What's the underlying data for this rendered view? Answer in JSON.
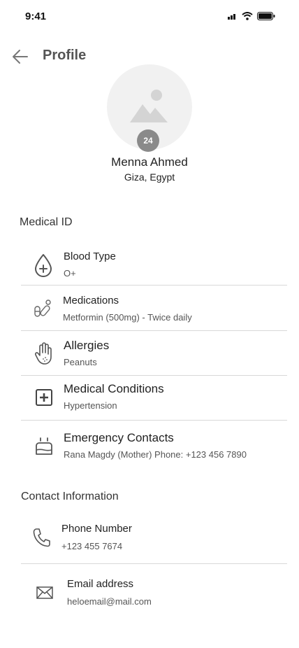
{
  "status_bar": {
    "time": "9:41"
  },
  "header": {
    "title": "Profile"
  },
  "profile": {
    "age_badge": "24",
    "name": "Menna Ahmed",
    "location": "Giza, Egypt"
  },
  "medical": {
    "section_title": "Medical ID",
    "items": [
      {
        "title": "Blood Type",
        "value": "O+",
        "icon": "blood-drop-plus-icon"
      },
      {
        "title": "Medications",
        "value": "Metformin (500mg) - Twice daily",
        "icon": "pills-icon"
      },
      {
        "title": "Allergies",
        "value": "Peanuts",
        "icon": "hand-icon"
      },
      {
        "title": "Medical Conditions",
        "value": "Hypertension",
        "icon": "medical-box-icon"
      },
      {
        "title": "Emergency Contacts",
        "value": "Rana Magdy (Mother) Phone: +123 456 7890",
        "icon": "emergency-light-icon"
      }
    ]
  },
  "contact": {
    "section_title": "Contact Information",
    "items": [
      {
        "title": "Phone Number",
        "value": "+123 455 7674",
        "icon": "phone-icon"
      },
      {
        "title": "Email address",
        "value": "heloemail@mail.com",
        "icon": "mail-icon"
      }
    ]
  }
}
